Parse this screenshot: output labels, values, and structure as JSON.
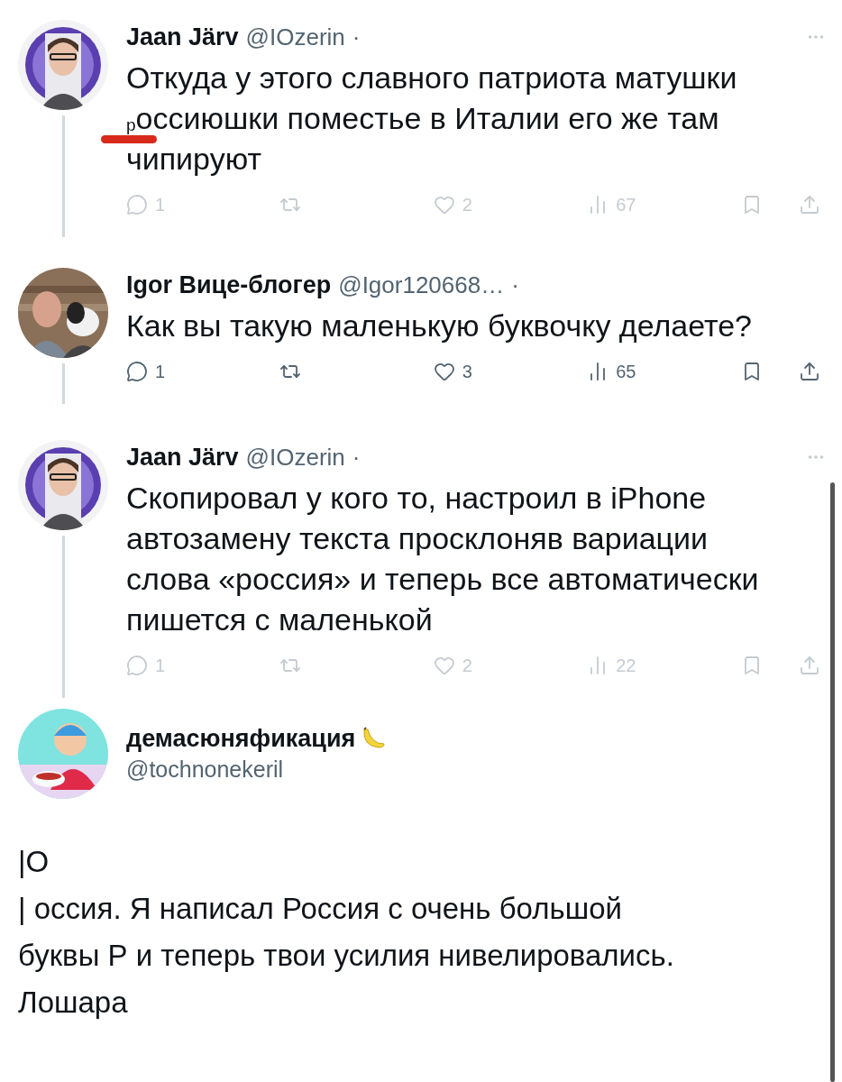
{
  "thread": [
    {
      "name": "Jaan Järv",
      "handle": "@IOzerin",
      "dot": "·",
      "body": "Откуда у этого славного патриота матушки $_{р}$оссиюшки поместье в Италии его же там чипируют",
      "marked": true,
      "faded": true,
      "more_menu": true,
      "avatar": {
        "kind": "pattern"
      },
      "actions": [
        {
          "kind": "reply",
          "count": "1"
        },
        {
          "kind": "repost"
        },
        {
          "kind": "like",
          "count": "2"
        },
        {
          "kind": "views",
          "count": "67"
        },
        {
          "kind": "bookmark"
        },
        {
          "kind": "share"
        }
      ]
    },
    {
      "name": "Igor Вице-блогер",
      "handle": "@Igor120668…",
      "dot": "·",
      "body": "Как вы такую маленькую буквочку делаете?",
      "marked": false,
      "faded": false,
      "more_menu": false,
      "avatar": {
        "kind": "dog"
      },
      "actions": [
        {
          "kind": "reply",
          "count": "1"
        },
        {
          "kind": "repost"
        },
        {
          "kind": "like",
          "count": "3"
        },
        {
          "kind": "views",
          "count": "65"
        },
        {
          "kind": "bookmark"
        },
        {
          "kind": "share"
        }
      ]
    },
    {
      "name": "Jaan Järv",
      "handle": "@IOzerin",
      "dot": "·",
      "body": "Скопировал у кого то, настроил в iPhone автозамену текста просклоняв вариации слова «россия» и теперь все автоматически пишется с маленькой",
      "marked": false,
      "faded": true,
      "more_menu": true,
      "avatar": {
        "kind": "pattern"
      },
      "actions": [
        {
          "kind": "reply",
          "count": "1"
        },
        {
          "kind": "repost"
        },
        {
          "kind": "like",
          "count": "2"
        },
        {
          "kind": "views",
          "count": "22"
        },
        {
          "kind": "bookmark"
        },
        {
          "kind": "share"
        }
      ]
    }
  ],
  "reply": {
    "name": "демасюняфикация",
    "handle": "@tochnonekeril",
    "lines": [
      "|О",
      "| оссия. Я написал Россия с очень большой",
      "буквы Р и теперь твои усилия нивелировались.",
      "Лошара"
    ]
  }
}
